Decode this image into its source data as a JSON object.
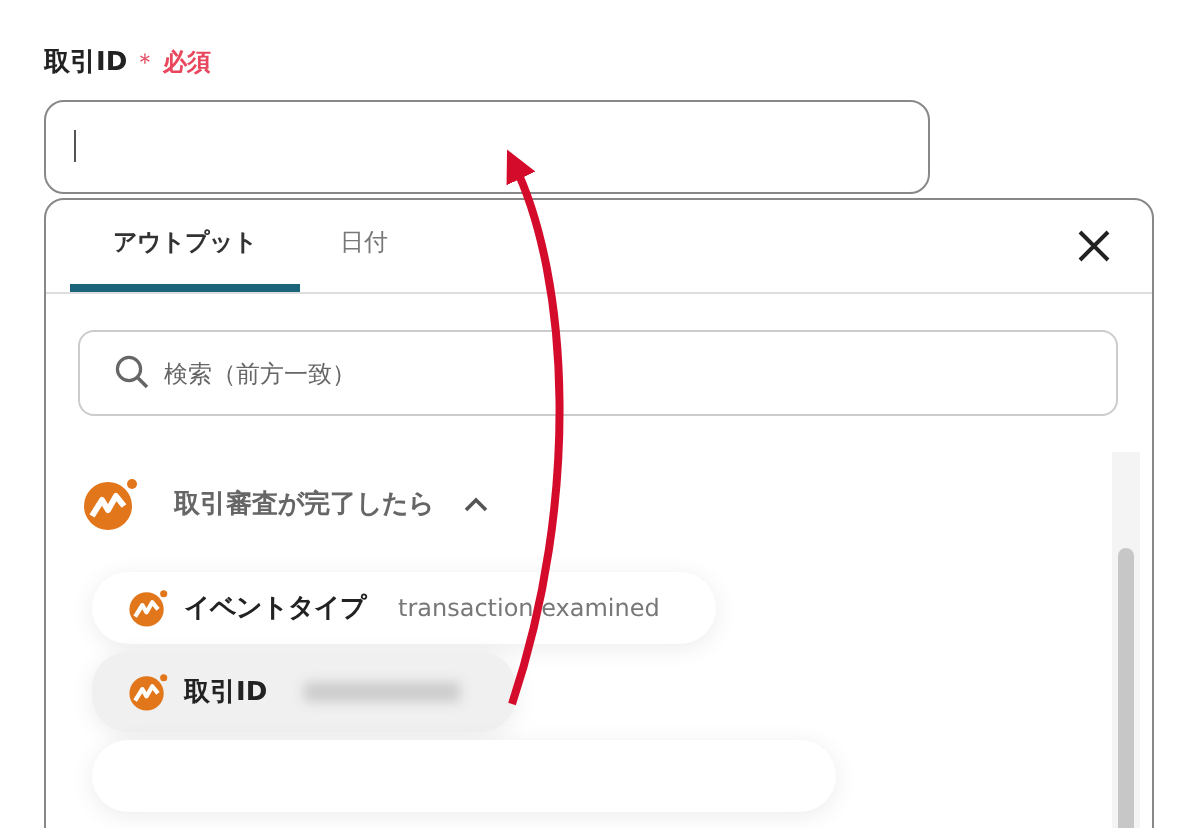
{
  "field": {
    "label": "取引ID",
    "required_mark": "＊",
    "required_text": "必須"
  },
  "tabs": [
    {
      "label": "アウトプット",
      "selected": true
    },
    {
      "label": "日付",
      "selected": false
    }
  ],
  "search": {
    "placeholder": "検索（前方一致）"
  },
  "group": {
    "title": "取引審査が完了したら",
    "expanded": true,
    "items": [
      {
        "label": "イベントタイプ",
        "value": "transaction.examined",
        "selected": false,
        "value_hidden": false
      },
      {
        "label": "取引ID",
        "selected": true,
        "value_hidden": true
      }
    ]
  }
}
